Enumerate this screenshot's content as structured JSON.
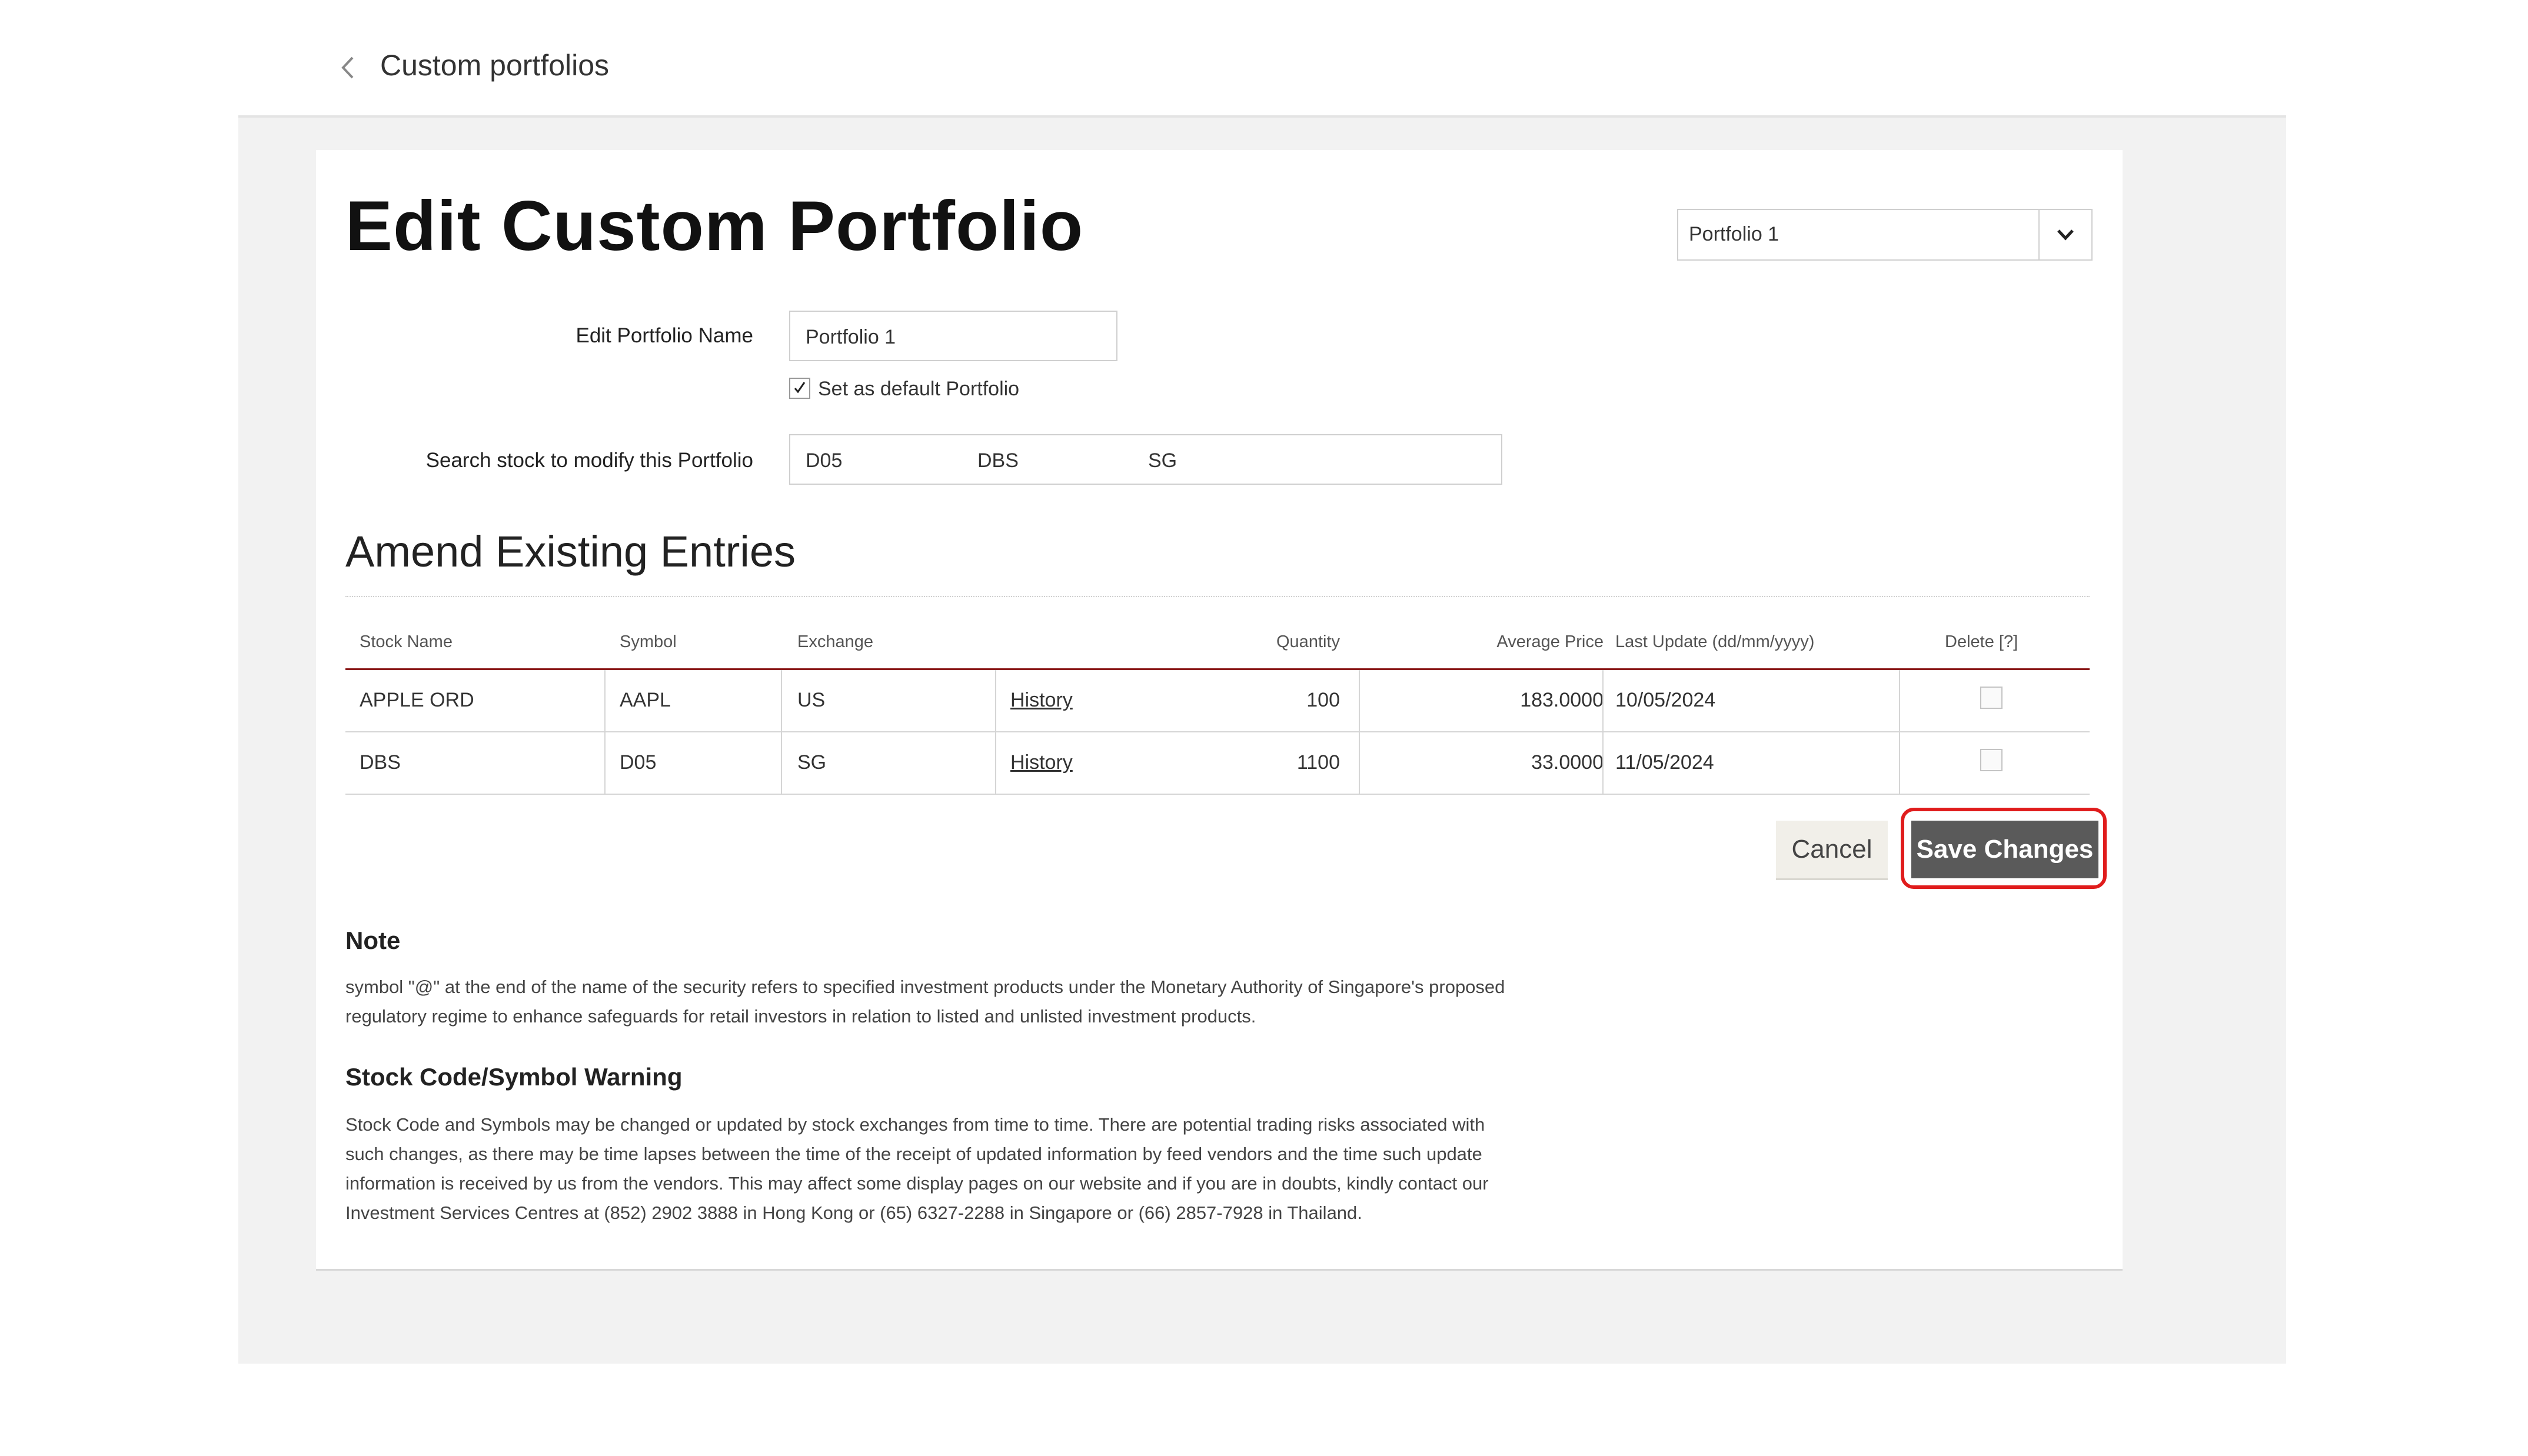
{
  "breadcrumb": {
    "title": "Custom portfolios"
  },
  "page": {
    "title": "Edit Custom Portfolio"
  },
  "portfolio_selector": {
    "value": "Portfolio 1"
  },
  "form": {
    "name_label": "Edit Portfolio Name",
    "name_value": "Portfolio 1",
    "default_label": "Set as default Portfolio",
    "default_checked": true,
    "search_label": "Search stock to modify this Portfolio",
    "search_tokens": [
      "D05",
      "DBS",
      "SG"
    ]
  },
  "section": {
    "title": "Amend Existing Entries"
  },
  "table": {
    "headers": [
      "Stock Name",
      "Symbol",
      "Exchange",
      "Quantity",
      "Average Price",
      "Last Update (dd/mm/yyyy)",
      "Delete [?]"
    ],
    "rows": [
      {
        "stock_name": "APPLE ORD",
        "symbol": "AAPL",
        "exchange": "US",
        "history": "History",
        "quantity": "100",
        "average_price": "183.0000",
        "last_update": "10/05/2024",
        "delete": false
      },
      {
        "stock_name": "DBS",
        "symbol": "D05",
        "exchange": "SG",
        "history": "History",
        "quantity": "1100",
        "average_price": "33.0000",
        "last_update": "11/05/2024",
        "delete": false
      }
    ]
  },
  "buttons": {
    "cancel": "Cancel",
    "save": "Save Changes"
  },
  "note": {
    "title": "Note",
    "text": "symbol \"@\" at the end of the name of the security refers to specified investment products under the Monetary Authority of Singapore's proposed regulatory regime to enhance safeguards for retail investors in relation to listed and unlisted investment products."
  },
  "warning": {
    "title": "Stock Code/Symbol Warning",
    "text": "Stock Code and Symbols may be changed or updated by stock exchanges from time to time. There are potential trading risks associated with such changes, as there may be time lapses between the time of the receipt of updated information by feed vendors and the time such update information is received by us from the vendors. This may affect some display pages on our website and if you are in doubts, kindly contact our Investment Services Centres at (852) 2902 3888 in Hong Kong or (65) 6327-2288 in Singapore or (66) 2857-7928 in Thailand."
  },
  "colors": {
    "accent_rule": "#8b1a1a",
    "highlight": "#e01c1c",
    "save_button": "#5a5a5a"
  },
  "icons": {
    "back": "chevron-left-icon",
    "dropdown": "chevron-down-icon",
    "check": "checkmark-icon"
  }
}
